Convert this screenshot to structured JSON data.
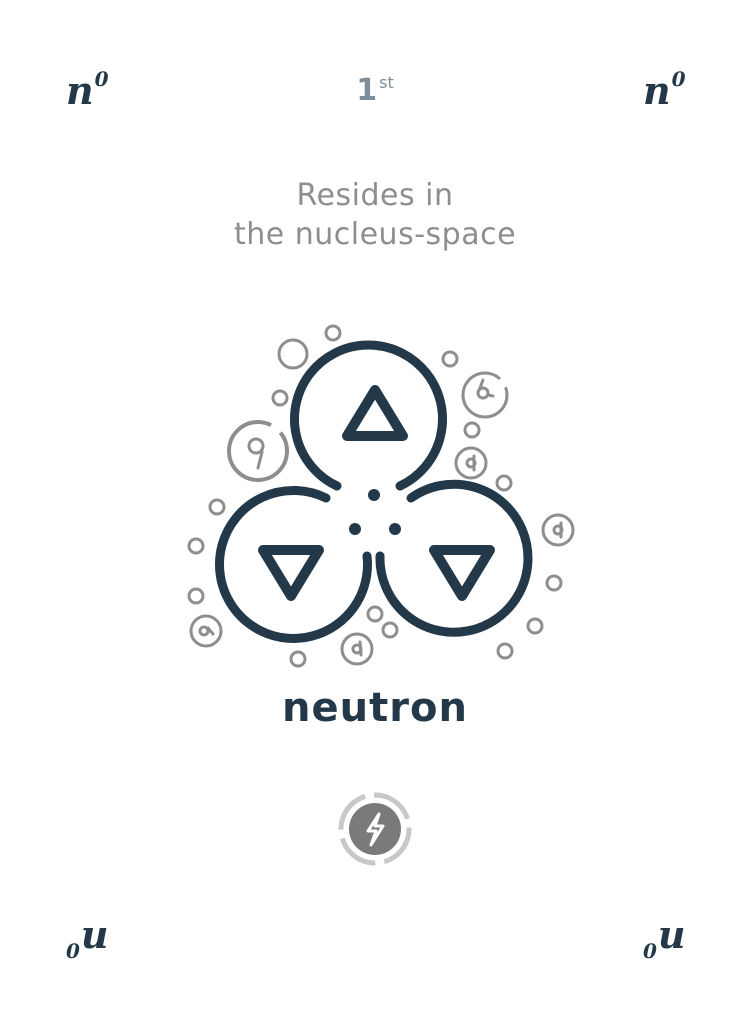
{
  "card": {
    "corner_top_left": {
      "main": "n",
      "sup": "0"
    },
    "corner_top_right": {
      "main": "n",
      "sup": "0"
    },
    "corner_bottom_left": {
      "sub": "0",
      "main": "u"
    },
    "corner_bottom_right": {
      "sub": "0",
      "main": "u"
    },
    "rank": {
      "number": "1",
      "suffix": "st"
    },
    "description": {
      "line1": "Resides in",
      "line2": "the nucleus-space"
    },
    "name": "neutron",
    "power_button_icon": "lightning-bolt-icon"
  },
  "colors": {
    "primary": "#23394a",
    "secondary_gray": "#8e8e8e",
    "rank_gray": "#7e8d99",
    "background": "#ffffff"
  }
}
